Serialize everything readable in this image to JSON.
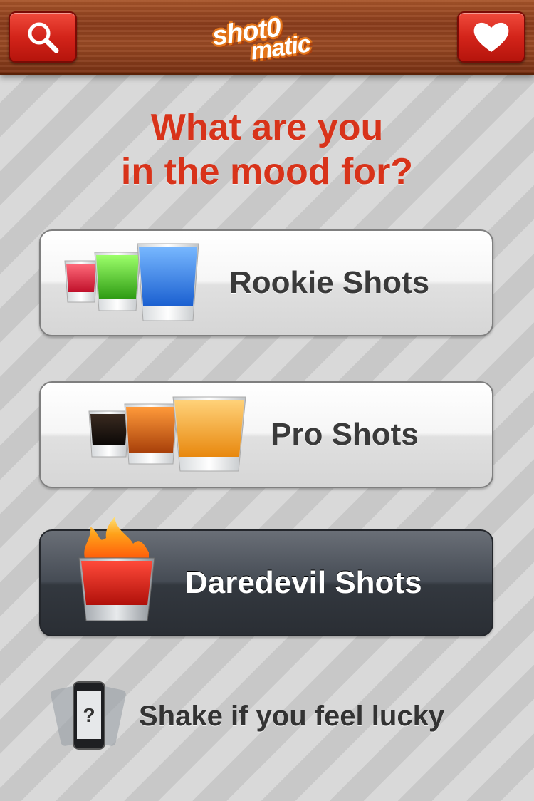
{
  "app": {
    "logo_text_top": "shot0",
    "logo_text_bottom": "matic"
  },
  "headline": {
    "line1": "What are you",
    "line2": "in the mood for?"
  },
  "options": [
    {
      "label": "Rookie Shots"
    },
    {
      "label": "Pro Shots"
    },
    {
      "label": "Daredevil Shots"
    }
  ],
  "shake": {
    "label": "Shake if you feel lucky",
    "icon_glyph": "?"
  },
  "icons": {
    "search": "search-icon",
    "favorites": "heart-icon",
    "shake": "phone-shake-icon"
  },
  "colors": {
    "accent_red": "#d8331a",
    "button_red": "#d3241a",
    "wood": "#8b3d1c",
    "dark_button": "#33383f"
  }
}
